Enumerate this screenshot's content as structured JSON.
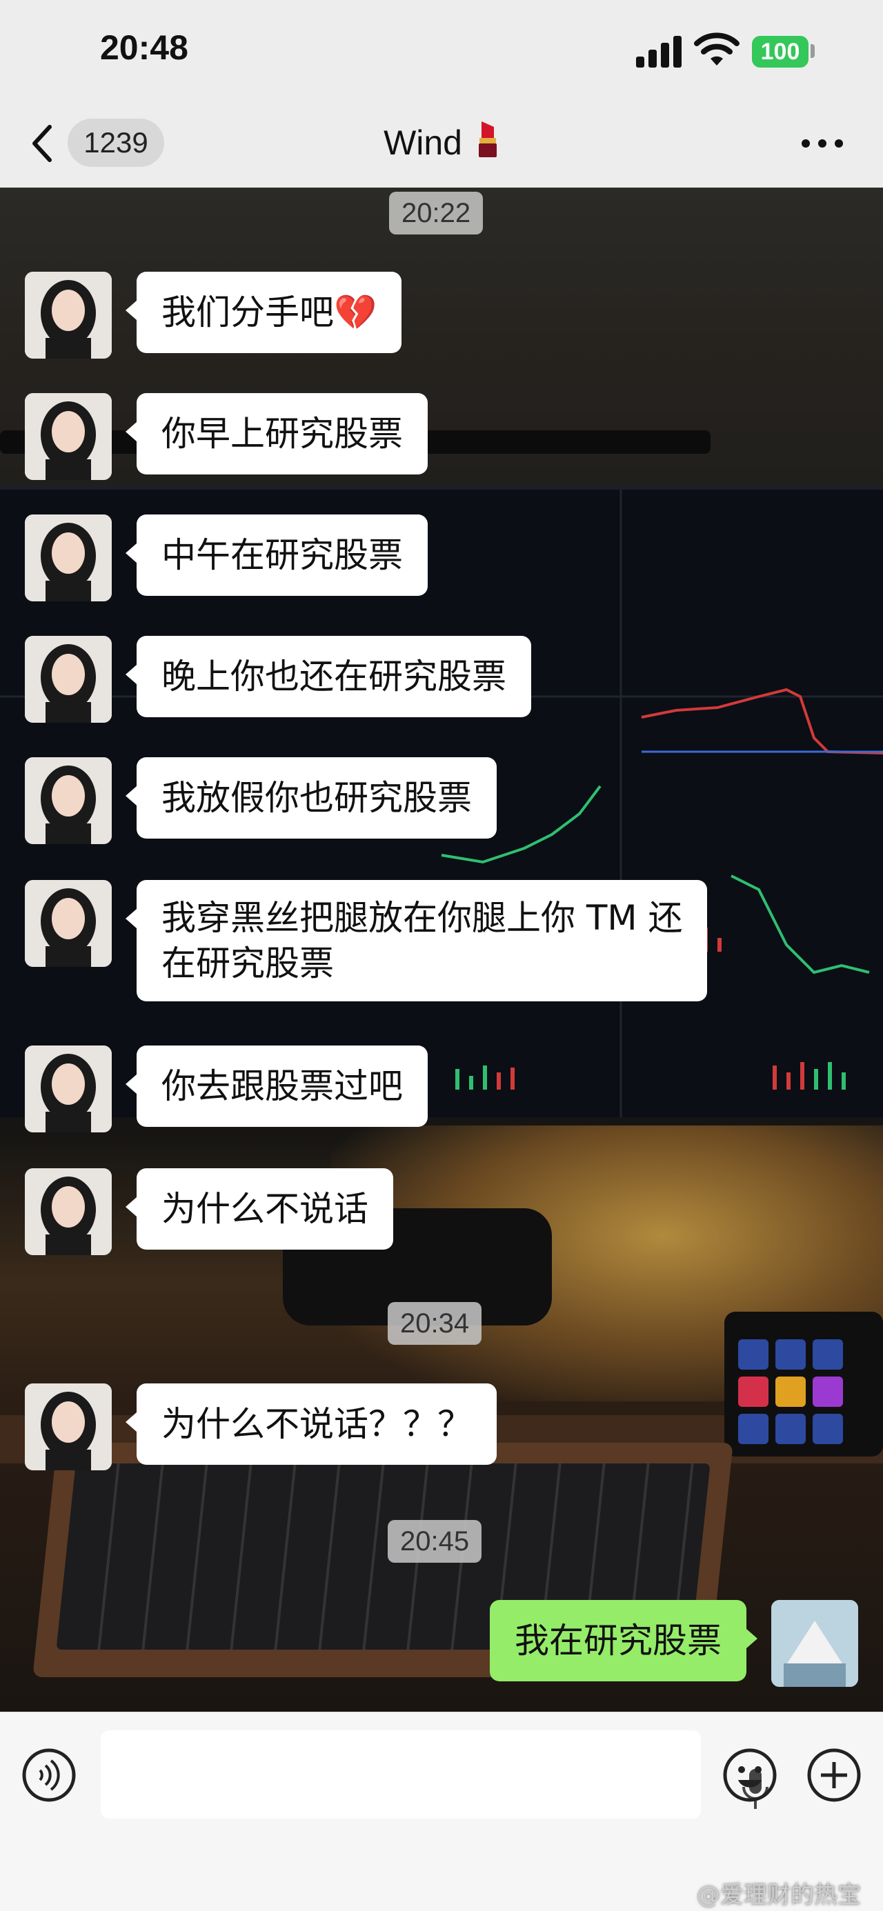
{
  "status_bar": {
    "time": "20:48",
    "battery": "100"
  },
  "nav": {
    "unread_count": "1239",
    "title": "Wind"
  },
  "messages": [
    {
      "type": "timestamp",
      "text": "20:22"
    },
    {
      "type": "incoming",
      "text": "我们分手吧💔"
    },
    {
      "type": "incoming",
      "text": "你早上研究股票"
    },
    {
      "type": "incoming",
      "text": "中午在研究股票"
    },
    {
      "type": "incoming",
      "text": "晚上你也还在研究股票"
    },
    {
      "type": "incoming",
      "text": "我放假你也研究股票"
    },
    {
      "type": "incoming",
      "line1": "我穿黑丝把腿放在你腿上你 TM 还",
      "line2": "在研究股票"
    },
    {
      "type": "incoming",
      "text": "你去跟股票过吧"
    },
    {
      "type": "incoming",
      "text": "为什么不说话"
    },
    {
      "type": "timestamp",
      "text": "20:34"
    },
    {
      "type": "incoming",
      "text": "为什么不说话？？？"
    },
    {
      "type": "timestamp",
      "text": "20:45"
    },
    {
      "type": "outgoing",
      "text": "我在研究股票"
    }
  ],
  "input_bar": {
    "icons": [
      "voice-icon",
      "microphone-icon",
      "emoji-icon",
      "plus-icon"
    ]
  },
  "watermark": "@爱理财的热宝",
  "colors": {
    "outgoing_bubble": "#95ec69",
    "incoming_bubble": "#ffffff",
    "nav_bg": "#ededed"
  }
}
